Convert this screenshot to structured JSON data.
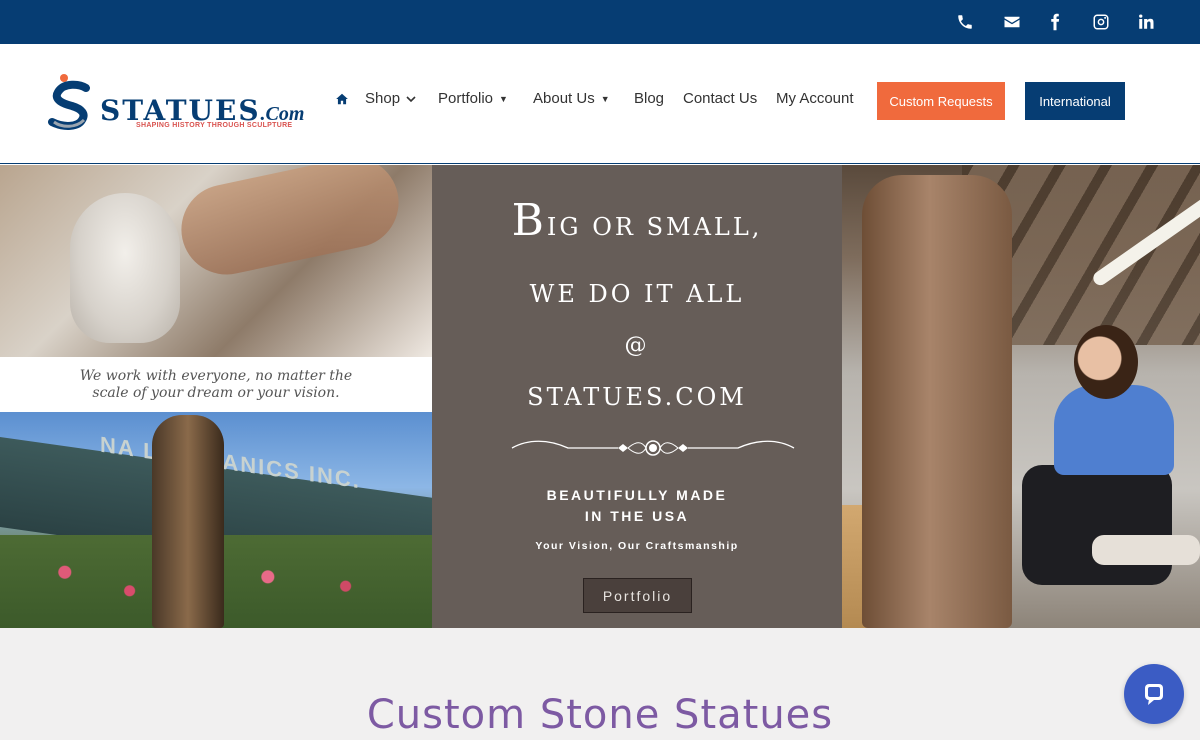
{
  "topbar": {
    "icons": [
      "phone-icon",
      "envelope-icon",
      "facebook-icon",
      "instagram-icon",
      "linkedin-icon"
    ],
    "background": "#063d73"
  },
  "header": {
    "logo_text": "STATUES",
    "logo_suffix": ".Com",
    "logo_tagline": "SHAPING HISTORY THROUGH SCULPTURE",
    "nav": {
      "shop": "Shop",
      "portfolio": "Portfolio",
      "about": "About Us",
      "blog": "Blog",
      "contact": "Contact Us",
      "account": "My Account"
    },
    "custom_requests": "Custom Requests",
    "international": "International",
    "accent": "#f06a3d",
    "brand": "#063d73"
  },
  "hero": {
    "left_caption_line1": "We work with everyone, no matter the",
    "left_caption_line2": "scale of your dream or your vision.",
    "left_sign": "NA      L ORGANICS INC.",
    "big_b": "B",
    "line1_rest": "IG OR SMALL,",
    "line2": "WE DO IT ALL",
    "line3": "@",
    "line4": "STATUES.COM",
    "beautifully_line1": "BEAUTIFULLY MADE",
    "beautifully_line2": "IN THE USA",
    "tagline": "Your Vision, Our Craftsmanship",
    "portfolio_button": "Portfolio",
    "panel_color": "#665d58"
  },
  "section": {
    "title": "Custom Stone Statues",
    "title_color": "#7d5aa3"
  },
  "chat": {
    "icon": "chat-icon",
    "color": "#3b5cc4"
  }
}
